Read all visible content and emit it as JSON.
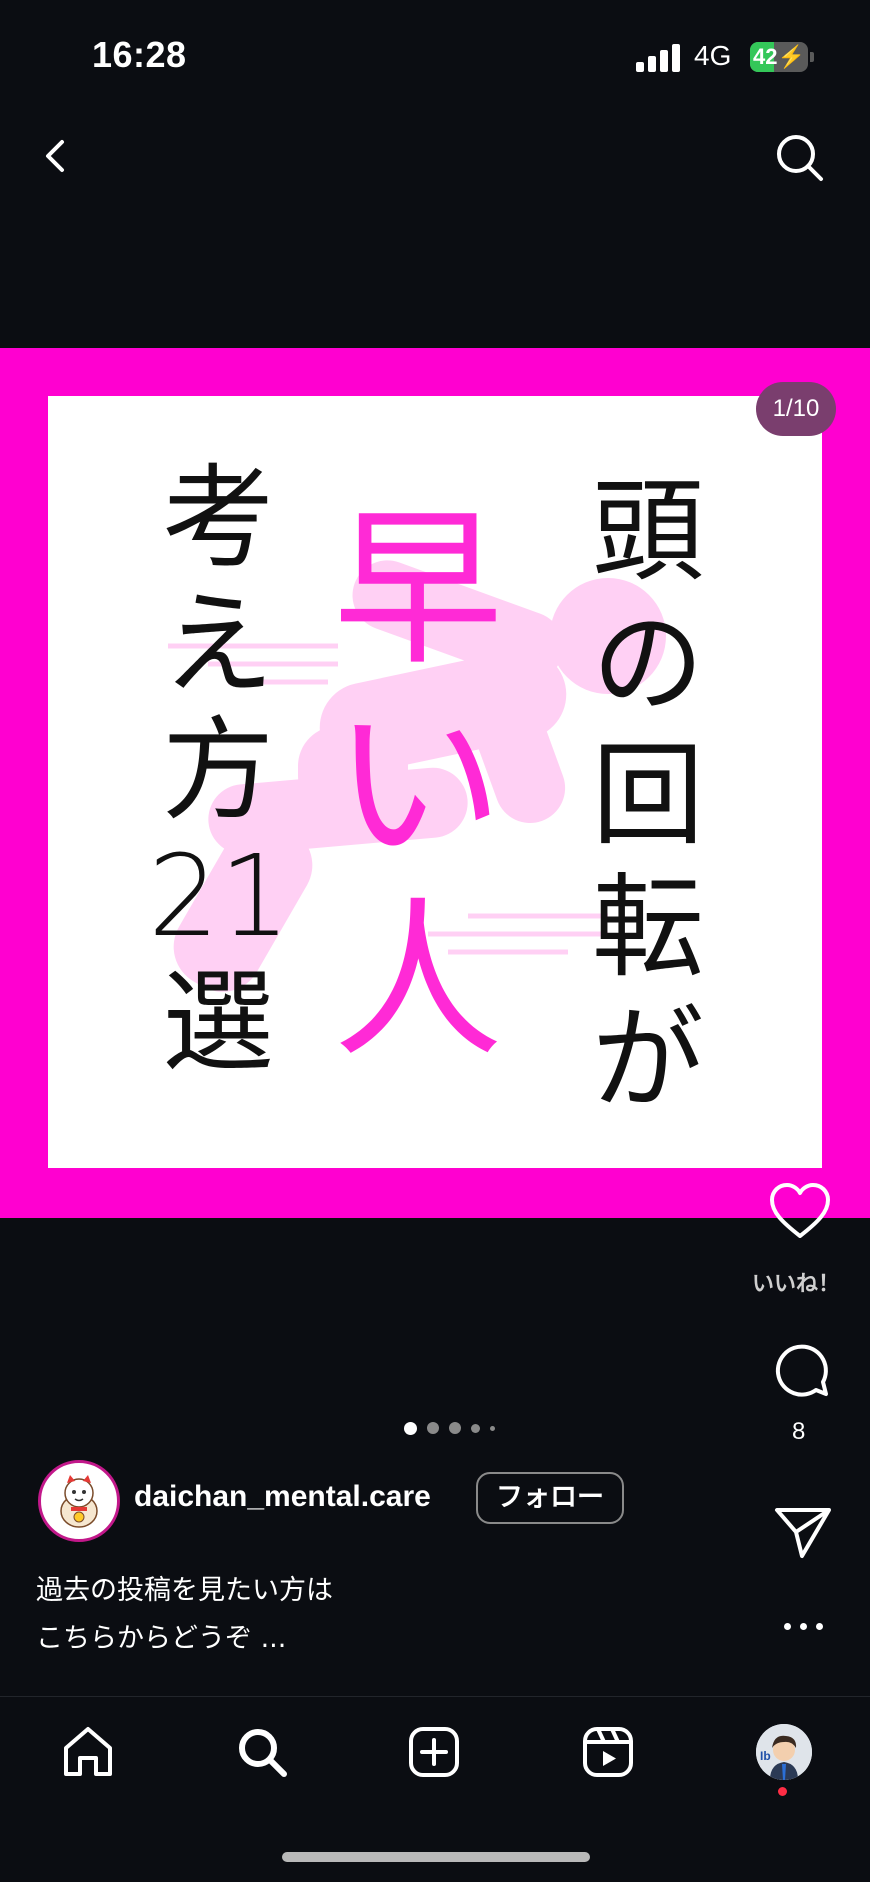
{
  "status_bar": {
    "time": "16:28",
    "network": "4G",
    "battery_level": "42",
    "battery_fraction": 0.42,
    "charging": true
  },
  "header": {
    "back_icon": "chevron-left-icon",
    "search_icon": "search-icon"
  },
  "post": {
    "page_indicator": "1/10",
    "title_right_column": "頭の回転が",
    "title_middle_column": "早い人",
    "title_left_column": "考え方21選",
    "colors": {
      "frame": "#ff00d0",
      "accent_text": "#ff2ad6",
      "figure": "#ffd0f4"
    },
    "carousel_dot_count": 5,
    "carousel_active_index": 0
  },
  "actions": {
    "like_icon": "heart-icon",
    "like_label": "いいね！",
    "comment_icon": "comment-icon",
    "comment_count": "8",
    "share_icon": "paper-plane-icon",
    "more_icon": "more-horizontal-icon"
  },
  "author": {
    "username": "daichan_mental.care",
    "follow_label": "フォロー",
    "avatar_icon": "lucky-cat-avatar"
  },
  "caption": {
    "line1": "過去の投稿を見たい方は",
    "line2": "こちらからどうぞ ..."
  },
  "bottom_nav": {
    "items": [
      {
        "icon": "home-icon"
      },
      {
        "icon": "search-icon"
      },
      {
        "icon": "create-plus-icon"
      },
      {
        "icon": "reels-icon"
      },
      {
        "icon": "profile-avatar"
      }
    ],
    "notification_dot_color": "#ff2d45"
  }
}
